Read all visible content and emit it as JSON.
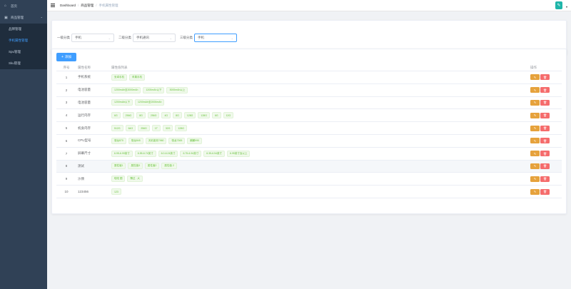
{
  "sidebar": {
    "home": {
      "label": "首页",
      "icon": "dashboard-icon"
    },
    "group": {
      "label": "商品管理",
      "icon": "goods-icon"
    },
    "items": [
      {
        "label": "品牌管理",
        "active": false
      },
      {
        "label": "手机属性管理",
        "active": true
      },
      {
        "label": "Spu管理",
        "active": false
      },
      {
        "label": "Sku管理",
        "active": false
      }
    ]
  },
  "header": {
    "breadcrumb": [
      "Dashboard",
      "商品管理",
      "手机属性管理"
    ]
  },
  "filters": {
    "level1_label": "一级分类",
    "level1_value": "手机",
    "level2_label": "二级分类",
    "level2_value": "手机通讯",
    "level3_label": "三级分类",
    "level3_value": "手机"
  },
  "table": {
    "add_label": "添加",
    "columns": [
      "序号",
      "属性名称",
      "属性值列表",
      "操作"
    ],
    "rows": [
      {
        "index": "1",
        "name": "手机系统",
        "values": [
          "安卓手机",
          "苹果手机"
        ]
      },
      {
        "index": "2",
        "name": "电池容量",
        "values": [
          "1200mAh至2000mAh",
          "1200mAh以下",
          "3000mAh以上"
        ]
      },
      {
        "index": "3",
        "name": "电池容量",
        "values": [
          "1200mAh以下",
          "1200mAh至2000mAh"
        ]
      },
      {
        "index": "4",
        "name": "运行内存",
        "values": [
          "6G",
          "256G",
          "8G",
          "256G",
          "4G",
          "8G",
          "128G",
          "128G",
          "6G",
          "12G"
        ]
      },
      {
        "index": "5",
        "name": "机身内存",
        "values": [
          "512G",
          "64G",
          "256G",
          "1T",
          "32G",
          "128G"
        ]
      },
      {
        "index": "6",
        "name": "CPU型号",
        "values": [
          "骁龙870",
          "骁龙845",
          "天玑能效7960",
          "骁龙7365",
          "麒麟990"
        ]
      },
      {
        "index": "7",
        "name": "屏幕尺寸",
        "values": [
          "6.95-6.99英寸",
          "6.55-6.74英寸",
          "6.0-6.24英寸",
          "6.75-6.94英寸",
          "6.35-6.54英寸",
          "6.95英寸及以上"
        ]
      },
      {
        "index": "8",
        "name": "测试",
        "values": [
          "属性值1",
          "属性值3",
          "属性值2",
          "属性值 2"
        ]
      },
      {
        "index": "9",
        "name": "沙颈",
        "values": [
          "啦啦 图",
          "飘过 . 大"
        ]
      },
      {
        "index": "10",
        "name": "123456",
        "values": [
          "123"
        ]
      }
    ]
  },
  "colors": {
    "sidebar_bg": "#304156",
    "primary": "#409eff",
    "warning": "#e6a23c",
    "danger": "#f56c6c",
    "tag_green": "#67c23a"
  }
}
